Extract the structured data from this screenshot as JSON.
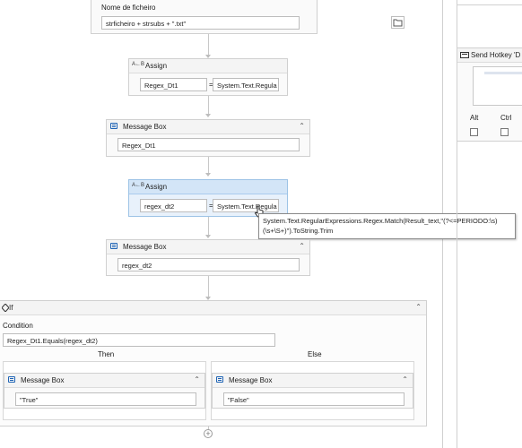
{
  "workflow": {
    "filename_activity": {
      "label": "Nome de ficheiro",
      "value": "strficheiro + strsubs + \".txt\""
    },
    "assign1": {
      "title": "Assign",
      "to": "Regex_Dt1",
      "op": "=",
      "value": "System.Text.Regula"
    },
    "msgbox1": {
      "title": "Message Box",
      "text": "Regex_Dt1"
    },
    "assign2": {
      "title": "Assign",
      "to": "regex_dt2",
      "op": "=",
      "value": "System.Text.Regula"
    },
    "tooltip": "System.Text.RegularExpressions.Regex.Match(Result_text,\"(?<=PERIODO:\\s)(\\s+\\S+)\").ToString.Trim",
    "msgbox2": {
      "title": "Message Box",
      "text": "regex_dt2"
    },
    "if_activity": {
      "title": "If",
      "condition_label": "Condition",
      "condition": "Regex_Dt1.Equals(regex_dt2)",
      "then_label": "Then",
      "else_label": "Else",
      "then_msg": {
        "title": "Message Box",
        "text": "\"True\""
      },
      "else_msg": {
        "title": "Message Box",
        "text": "\"False\""
      }
    }
  },
  "side_panel": {
    "send_hotkey_title": "Send Hotkey 'D",
    "alt_label": "Alt",
    "ctrl_label": "Ctrl"
  },
  "icons": {
    "assign": "assign-icon",
    "message_box": "message-box-icon",
    "collapse": "collapse-chevron-icon",
    "folder": "folder-icon",
    "add": "add-activity-icon",
    "keyboard": "keyboard-icon"
  }
}
